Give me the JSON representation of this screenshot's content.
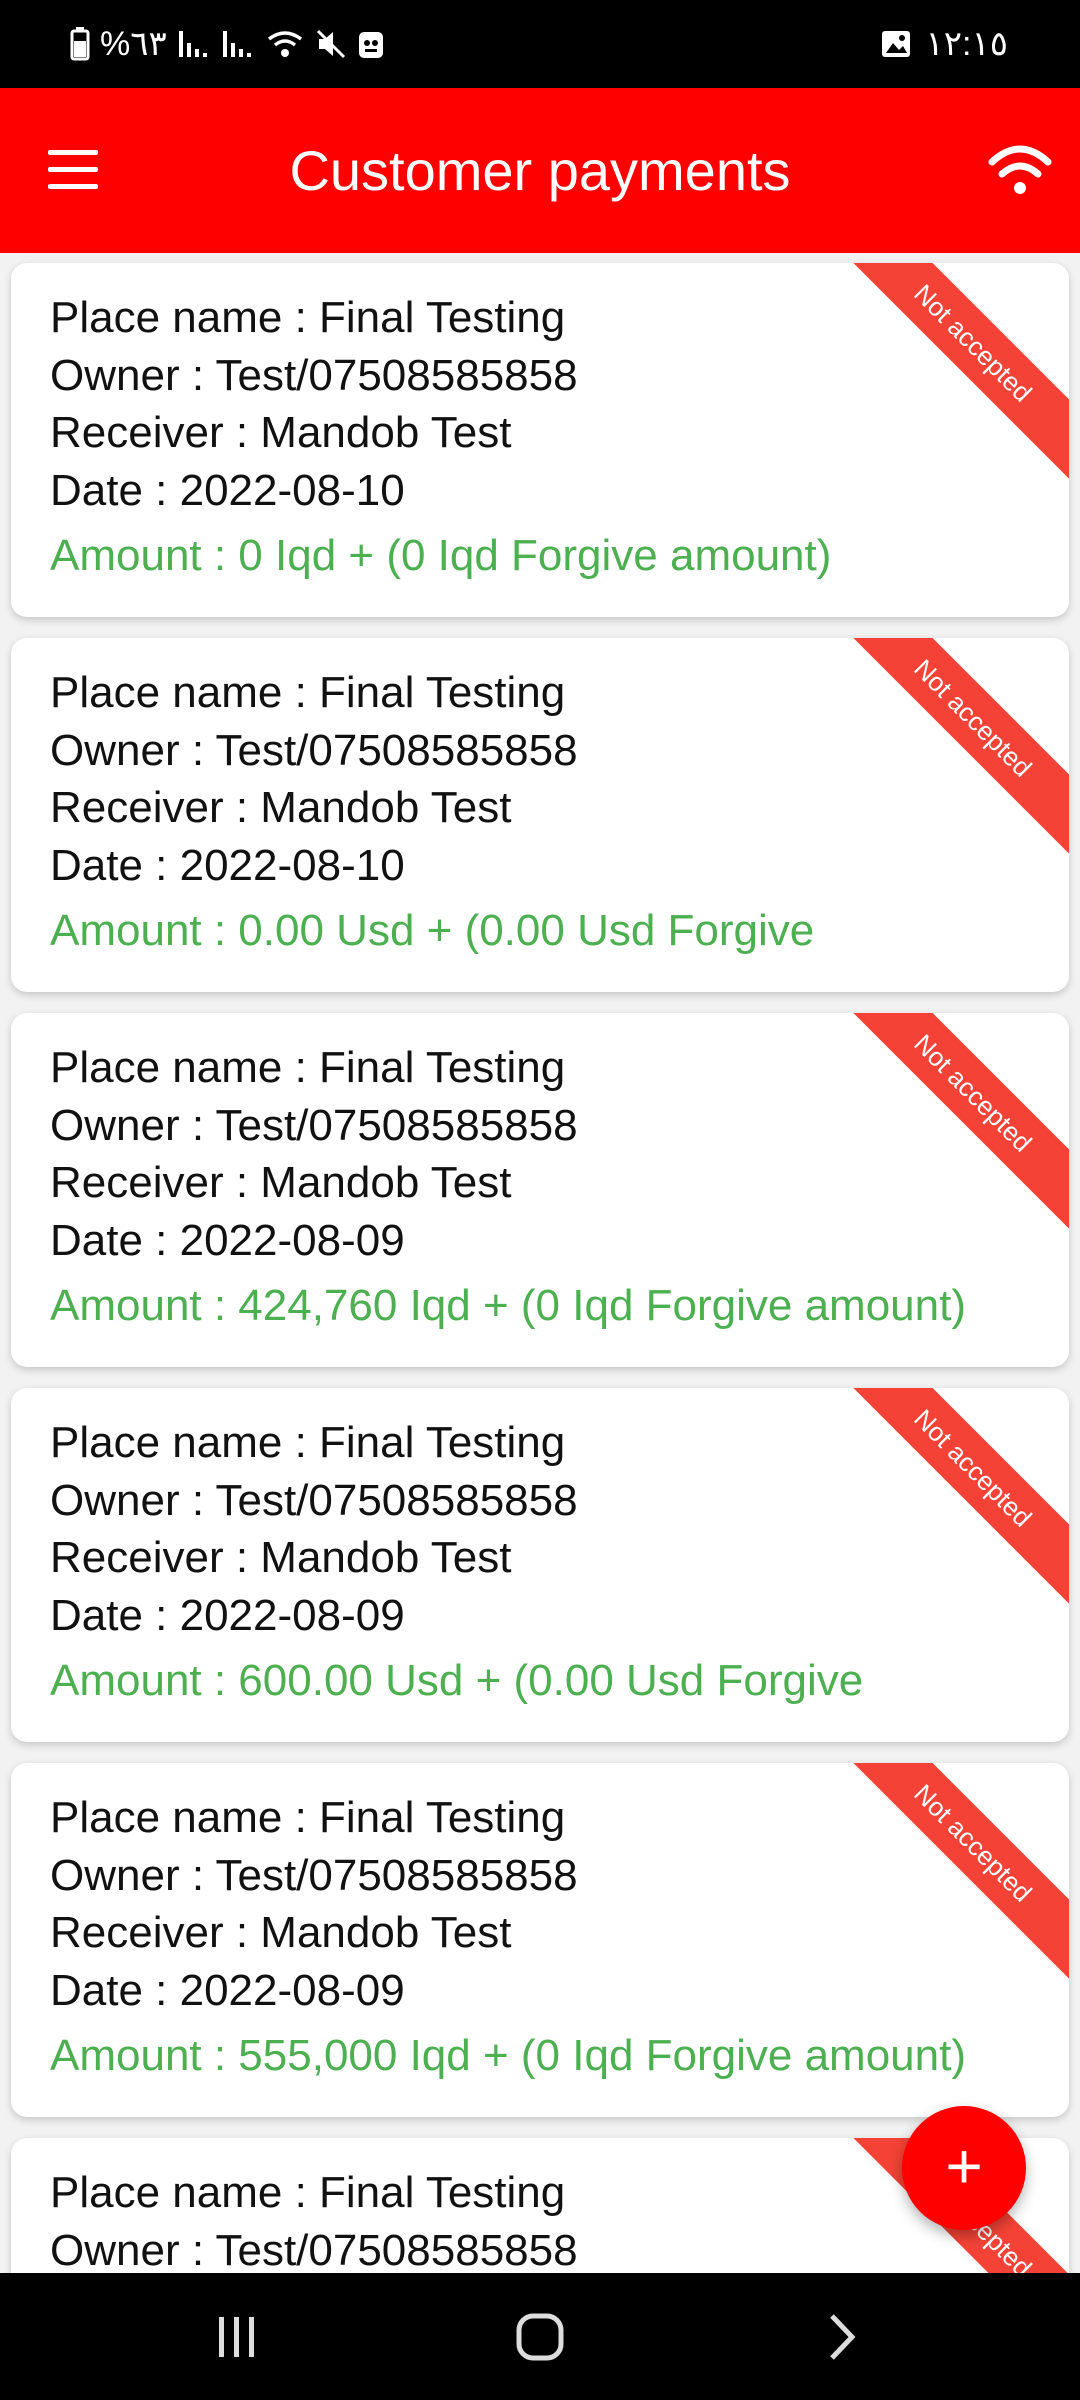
{
  "status_bar": {
    "left_text": "%٦٣",
    "time": "١٢:١٥"
  },
  "app_bar": {
    "title": "Customer payments"
  },
  "payments": [
    {
      "place": "Place name : Final Testing",
      "owner": "Owner : Test/07508585858",
      "receiver": "Receiver : Mandob Test",
      "date": "Date : 2022-08-10",
      "amount": "Amount : 0 Iqd + (0 Iqd Forgive amount)",
      "status": "Not accepted"
    },
    {
      "place": "Place name : Final Testing",
      "owner": "Owner : Test/07508585858",
      "receiver": "Receiver : Mandob Test",
      "date": "Date : 2022-08-10",
      "amount": "Amount : 0.00 Usd + (0.00 Usd Forgive",
      "status": "Not accepted"
    },
    {
      "place": "Place name : Final Testing",
      "owner": "Owner : Test/07508585858",
      "receiver": "Receiver : Mandob Test",
      "date": "Date : 2022-08-09",
      "amount": "Amount : 424,760 Iqd + (0 Iqd Forgive amount)",
      "status": "Not accepted"
    },
    {
      "place": "Place name : Final Testing",
      "owner": "Owner : Test/07508585858",
      "receiver": "Receiver : Mandob Test",
      "date": "Date : 2022-08-09",
      "amount": "Amount : 600.00 Usd + (0.00 Usd Forgive",
      "status": "Not accepted"
    },
    {
      "place": "Place name : Final Testing",
      "owner": "Owner : Test/07508585858",
      "receiver": "Receiver : Mandob Test",
      "date": "Date : 2022-08-09",
      "amount": "Amount : 555,000 Iqd + (0 Iqd Forgive amount)",
      "status": "Not accepted"
    },
    {
      "place": "Place name : Final Testing",
      "owner": "Owner : Test/07508585858",
      "receiver": "",
      "date": "",
      "amount": "",
      "status": "Not accepted"
    }
  ],
  "fab": {
    "label": "+"
  },
  "colors": {
    "app_bar": "#ff0000",
    "ribbon": "#f44336",
    "amount": "#4caf50"
  }
}
